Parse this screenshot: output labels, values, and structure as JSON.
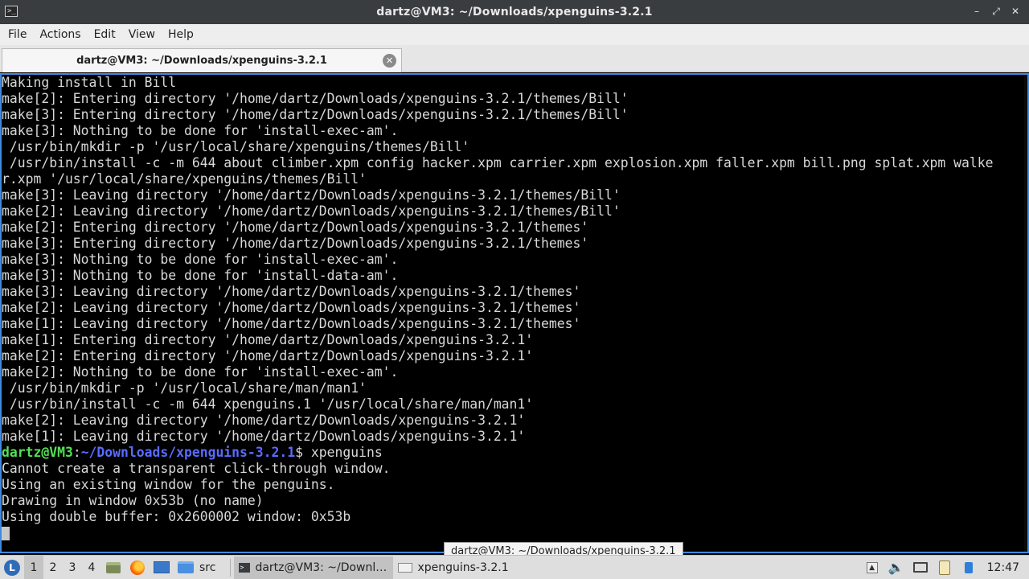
{
  "window": {
    "title": "dartz@VM3: ~/Downloads/xpenguins-3.2.1",
    "icon_glyph": ">_",
    "controls": {
      "minimize": "–",
      "maximize": "⤢",
      "close": "✕"
    }
  },
  "menu": [
    "File",
    "Actions",
    "Edit",
    "View",
    "Help"
  ],
  "tab": {
    "label": "dartz@VM3: ~/Downloads/xpenguins-3.2.1",
    "close_glyph": "✕"
  },
  "terminal": {
    "lines": [
      "Making install in Bill",
      "make[2]: Entering directory '/home/dartz/Downloads/xpenguins-3.2.1/themes/Bill'",
      "make[3]: Entering directory '/home/dartz/Downloads/xpenguins-3.2.1/themes/Bill'",
      "make[3]: Nothing to be done for 'install-exec-am'.",
      " /usr/bin/mkdir -p '/usr/local/share/xpenguins/themes/Bill'",
      " /usr/bin/install -c -m 644 about climber.xpm config hacker.xpm carrier.xpm explosion.xpm faller.xpm bill.png splat.xpm walke",
      "r.xpm '/usr/local/share/xpenguins/themes/Bill'",
      "make[3]: Leaving directory '/home/dartz/Downloads/xpenguins-3.2.1/themes/Bill'",
      "make[2]: Leaving directory '/home/dartz/Downloads/xpenguins-3.2.1/themes/Bill'",
      "make[2]: Entering directory '/home/dartz/Downloads/xpenguins-3.2.1/themes'",
      "make[3]: Entering directory '/home/dartz/Downloads/xpenguins-3.2.1/themes'",
      "make[3]: Nothing to be done for 'install-exec-am'.",
      "make[3]: Nothing to be done for 'install-data-am'.",
      "make[3]: Leaving directory '/home/dartz/Downloads/xpenguins-3.2.1/themes'",
      "make[2]: Leaving directory '/home/dartz/Downloads/xpenguins-3.2.1/themes'",
      "make[1]: Leaving directory '/home/dartz/Downloads/xpenguins-3.2.1/themes'",
      "make[1]: Entering directory '/home/dartz/Downloads/xpenguins-3.2.1'",
      "make[2]: Entering directory '/home/dartz/Downloads/xpenguins-3.2.1'",
      "make[2]: Nothing to be done for 'install-exec-am'.",
      " /usr/bin/mkdir -p '/usr/local/share/man/man1'",
      " /usr/bin/install -c -m 644 xpenguins.1 '/usr/local/share/man/man1'",
      "make[2]: Leaving directory '/home/dartz/Downloads/xpenguins-3.2.1'",
      "make[1]: Leaving directory '/home/dartz/Downloads/xpenguins-3.2.1'"
    ],
    "prompt": {
      "user_host": "dartz@VM3",
      "sep": ":",
      "path": "~/Downloads/xpenguins-3.2.1",
      "symbol": "$ ",
      "command": "xpenguins"
    },
    "output_after": [
      "Cannot create a transparent click-through window.",
      "Using an existing window for the penguins.",
      "Drawing in window 0x53b (no name)",
      "Using double buffer: 0x2600002 window: 0x53b"
    ]
  },
  "tooltip": "dartz@VM3: ~/Downloads/xpenguins-3.2.1",
  "taskbar": {
    "start_glyph": "L",
    "desktops": [
      "1",
      "2",
      "3",
      "4"
    ],
    "active_desktop": "1",
    "launchers": [
      "files-icon",
      "firefox-icon",
      "show-desktop-icon"
    ],
    "folder_label": "src",
    "tasks": [
      {
        "label": "dartz@VM3: ~/Downl…",
        "active": true
      },
      {
        "label": "xpenguins-3.2.1",
        "active": false
      }
    ],
    "tray_up_glyph": "▲",
    "tray_volume_glyph": "🔈",
    "clock": "12:47"
  }
}
